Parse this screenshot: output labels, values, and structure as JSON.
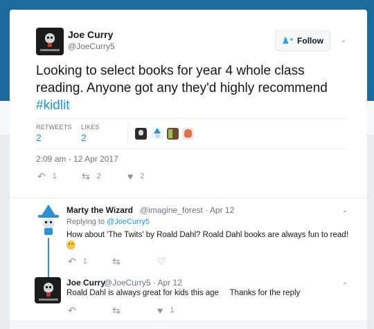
{
  "tweet": {
    "author_name": "Joe Curry",
    "author_handle": "@JoeCurry5",
    "follow_label": "Follow",
    "text_main": "Looking to select books for year 4 whole class reading. Anyone got any they'd highly recommend ",
    "hashtag": "#kidlit",
    "retweets_label": "RETWEETS",
    "retweets_count": "2",
    "likes_label": "LIKES",
    "likes_count": "2",
    "timestamp": "2:09 am - 12 Apr 2017",
    "actions": {
      "reply_count": "1",
      "retweet_count": "2",
      "like_count": "2"
    }
  },
  "replies": [
    {
      "name": "Marty the Wizard",
      "meta": "@imagine_forest · Apr 12",
      "replying_prefix": "Replying to ",
      "replying_handle": "@JoeCurry5",
      "text": "How about 'The Twits' by Roald Dahl? Roald Dahl books are always fun to read!",
      "actions": {
        "reply_count": "1",
        "retweet_count": "",
        "like_count": ""
      }
    },
    {
      "name": "Joe Curry",
      "meta": "@JoeCurry5 · Apr 12",
      "text": "Roald Dahl is always great for kids this age     Thanks for the reply",
      "actions": {
        "reply_count": "",
        "retweet_count": "",
        "like_count": "1"
      }
    }
  ],
  "icons": {
    "follow": "add-person-icon",
    "chevron": "chevron-down-icon",
    "reply": "reply-icon",
    "retweet": "retweet-icon",
    "like": "heart-icon"
  },
  "colors": {
    "accent": "#1b95e0",
    "header_blue": "#1b6c9d",
    "muted": "#657786"
  }
}
